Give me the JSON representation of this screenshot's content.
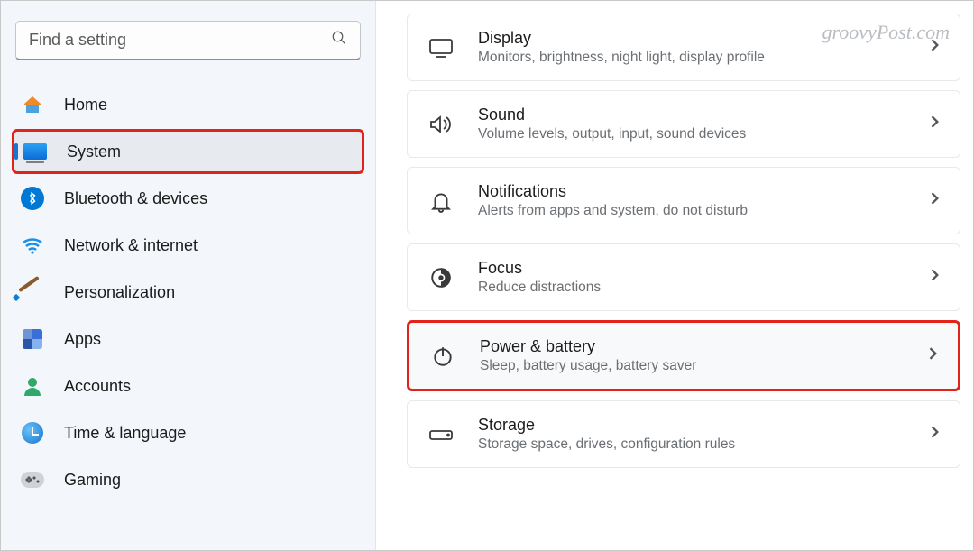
{
  "watermark": "groovyPost.com",
  "search": {
    "placeholder": "Find a setting"
  },
  "sidebar": {
    "items": [
      {
        "id": "home",
        "label": "Home",
        "icon": "home-icon",
        "selected": false,
        "highlighted": false
      },
      {
        "id": "system",
        "label": "System",
        "icon": "system-icon",
        "selected": true,
        "highlighted": true
      },
      {
        "id": "bluetooth",
        "label": "Bluetooth & devices",
        "icon": "bluetooth-icon",
        "selected": false,
        "highlighted": false
      },
      {
        "id": "network",
        "label": "Network & internet",
        "icon": "wifi-icon",
        "selected": false,
        "highlighted": false
      },
      {
        "id": "personalization",
        "label": "Personalization",
        "icon": "brush-icon",
        "selected": false,
        "highlighted": false
      },
      {
        "id": "apps",
        "label": "Apps",
        "icon": "apps-icon",
        "selected": false,
        "highlighted": false
      },
      {
        "id": "accounts",
        "label": "Accounts",
        "icon": "person-icon",
        "selected": false,
        "highlighted": false
      },
      {
        "id": "time",
        "label": "Time & language",
        "icon": "globe-clock-icon",
        "selected": false,
        "highlighted": false
      },
      {
        "id": "gaming",
        "label": "Gaming",
        "icon": "gamepad-icon",
        "selected": false,
        "highlighted": false
      }
    ]
  },
  "main": {
    "items": [
      {
        "id": "display",
        "title": "Display",
        "subtitle": "Monitors, brightness, night light, display profile",
        "icon": "monitor-icon",
        "highlighted": false
      },
      {
        "id": "sound",
        "title": "Sound",
        "subtitle": "Volume levels, output, input, sound devices",
        "icon": "speaker-icon",
        "highlighted": false
      },
      {
        "id": "notifications",
        "title": "Notifications",
        "subtitle": "Alerts from apps and system, do not disturb",
        "icon": "bell-icon",
        "highlighted": false
      },
      {
        "id": "focus",
        "title": "Focus",
        "subtitle": "Reduce distractions",
        "icon": "target-icon",
        "highlighted": false
      },
      {
        "id": "power",
        "title": "Power & battery",
        "subtitle": "Sleep, battery usage, battery saver",
        "icon": "power-icon",
        "highlighted": true
      },
      {
        "id": "storage",
        "title": "Storage",
        "subtitle": "Storage space, drives, configuration rules",
        "icon": "drive-icon",
        "highlighted": false
      }
    ]
  }
}
